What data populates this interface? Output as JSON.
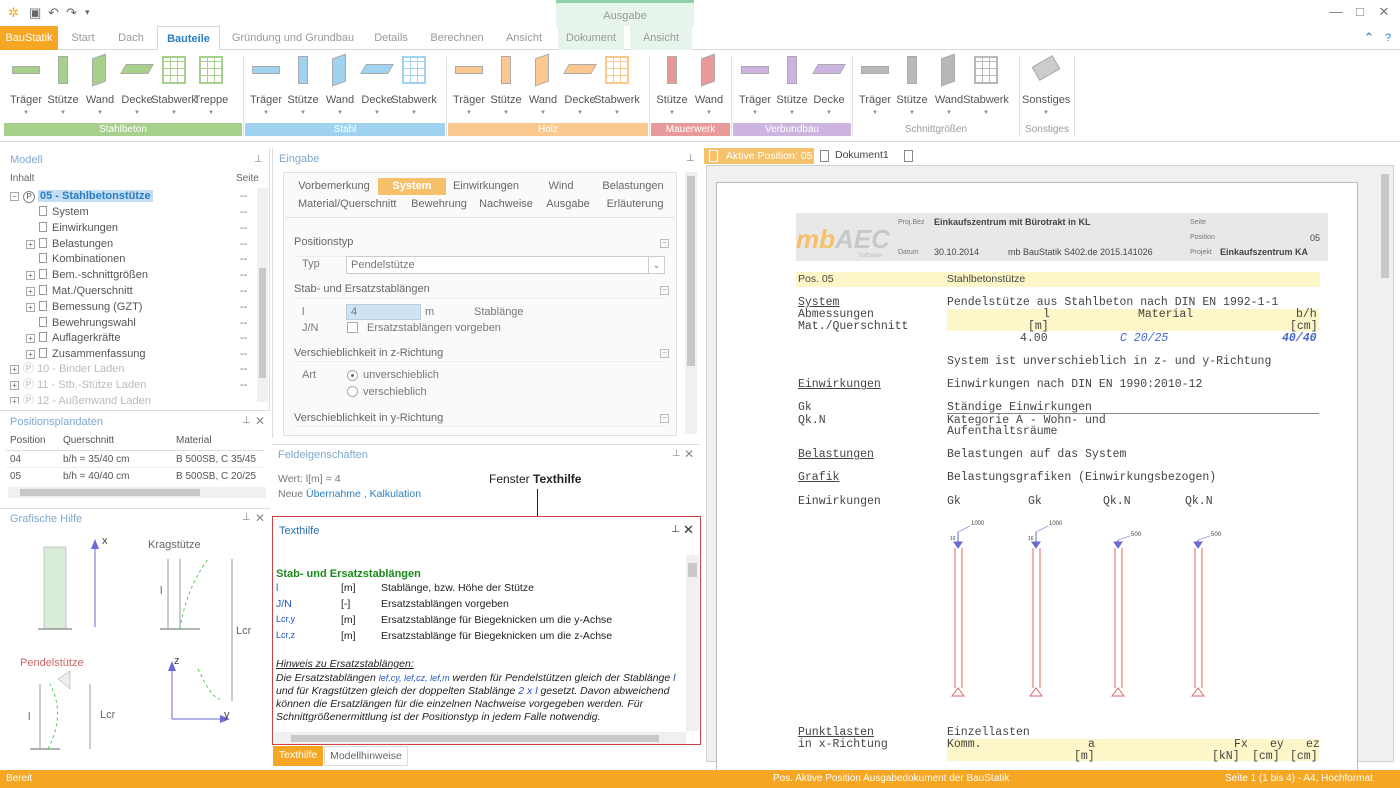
{
  "quick_access": {
    "save_icon": "save-icon",
    "undo_icon": "undo-icon",
    "redo_icon": "redo-icon"
  },
  "window": {
    "minimize": "—",
    "maximize": "□",
    "close": "✕"
  },
  "tabs": {
    "app": "BauStatik",
    "start": "Start",
    "dach": "Dach",
    "bauteile": "Bauteile",
    "gruendung": "Gründung und Grundbau",
    "details": "Details",
    "berechnen": "Berechnen",
    "ansicht": "Ansicht",
    "ctx_title": "Ausgabe",
    "dokument": "Dokument",
    "ansicht2": "Ansicht",
    "help": "?"
  },
  "ribbon": {
    "stahlbeton": [
      "Träger",
      "Stütze",
      "Wand",
      "Decke",
      "Stabwerk",
      "Treppe"
    ],
    "stahl": [
      "Träger",
      "Stütze",
      "Wand",
      "Decke",
      "Stabwerk"
    ],
    "holz": [
      "Träger",
      "Stütze",
      "Wand",
      "Decke",
      "Stabwerk"
    ],
    "mauerwerk": [
      "Stütze",
      "Wand"
    ],
    "verbundbau": [
      "Träger",
      "Stütze",
      "Decke"
    ],
    "schnittgroessen": [
      "Träger",
      "Stütze",
      "Wand",
      "Stabwerk"
    ],
    "sonstiges": [
      "Sonstiges"
    ],
    "groups": {
      "stahlbeton": "Stahlbeton",
      "stahl": "Stahl",
      "holz": "Holz",
      "mauerwerk": "Mauerwerk",
      "verbundbau": "Verbundbau",
      "schnittgroessen": "Schnittgrößen",
      "sonstiges": "Sonstiges"
    },
    "colors": {
      "stahlbeton": "#a8d08d",
      "stahl": "#9fd3ef",
      "holz": "#fbc990",
      "mauerwerk": "#e89a9a",
      "verbundbau": "#cdb4e0"
    }
  },
  "modell": {
    "title": "Modell",
    "col_inhalt": "Inhalt",
    "col_seite": "Seite",
    "root": "05 - Stahlbetonstütze",
    "root_badge": "P",
    "items": [
      {
        "label": "System",
        "val": "--",
        "exp": false
      },
      {
        "label": "Einwirkungen",
        "val": "--",
        "exp": false
      },
      {
        "label": "Belastungen",
        "val": "--",
        "exp": true
      },
      {
        "label": "Kombinationen",
        "val": "--",
        "exp": false
      },
      {
        "label": "Bem.-schnittgrößen",
        "val": "--",
        "exp": true
      },
      {
        "label": "Mat./Querschnitt",
        "val": "--",
        "exp": true
      },
      {
        "label": "Bemessung (GZT)",
        "val": "--",
        "exp": true
      },
      {
        "label": "Bewehrungswahl",
        "val": "--",
        "exp": false
      },
      {
        "label": "Auflagerkräfte",
        "val": "--",
        "exp": true
      },
      {
        "label": "Zusammenfassung",
        "val": "--",
        "exp": true
      }
    ],
    "other1": "10 - Binder Laden",
    "other2": "11 - Stb.-Stütze Laden",
    "other3": "12 - Außenwand Laden",
    "other_val": "--"
  },
  "positionsplan": {
    "title": "Positionsplandaten",
    "headers": [
      "Position",
      "Querschnitt",
      "Material"
    ],
    "rows": [
      [
        "04",
        "b/h = 35/40 cm",
        "B 500SB, C 35/45"
      ],
      [
        "05",
        "b/h = 40/40 cm",
        "B 500SB, C 20/25"
      ]
    ]
  },
  "grafische_hilfe": {
    "title": "Grafische Hilfe",
    "kragstuetze": "Kragstütze",
    "pendelstuetze": "Pendelstütze",
    "x": "x",
    "z": "z",
    "y": "y",
    "lcr": "Lcr",
    "l": "l"
  },
  "eingabe": {
    "title": "Eingabe",
    "tabs_row1": [
      "Vorbemerkung",
      "System",
      "Einwirkungen",
      "Wind",
      "Belastungen"
    ],
    "tabs_row2": [
      "Material/Querschnitt",
      "Bewehrung",
      "Nachweise",
      "Ausgabe",
      "Erläuterung"
    ],
    "sect_positionstyp": "Positionstyp",
    "typ_label": "Typ",
    "typ_value": "Pendelstütze",
    "sect_stab": "Stab- und Ersatzstablängen",
    "l_label": "l",
    "l_value": "4",
    "l_unit": "m",
    "l_desc": "Stablänge",
    "jn_label": "J/N",
    "jn_desc": "Ersatzstablängen vorgeben",
    "sect_vz": "Verschieblichkeit in z-Richtung",
    "art_label": "Art",
    "opt1": "unverschieblich",
    "opt2": "verschieblich",
    "sect_vy": "Verschieblichkeit in y-Richtung"
  },
  "feldeig": {
    "title": "Feldeigenschaften",
    "wert": "Wert: l[m] = 4",
    "neu": "Neue",
    "uebernahme": "Übernahme",
    "komma": ",",
    "kalkulation": "Kalkulation"
  },
  "annotation": {
    "prefix": "Fenster ",
    "bold": "Texthilfe"
  },
  "texthilfe": {
    "title": "Texthilfe",
    "heading": "Stab- und Ersatzstablängen",
    "rows": [
      {
        "sym": "l",
        "unit": "[m]",
        "desc": "Stablänge, bzw. Höhe der Stütze"
      },
      {
        "sym": "J/N",
        "unit": "[-]",
        "desc": "Ersatzstablängen vorgeben"
      },
      {
        "sym": "Lcr,y",
        "unit": "[m]",
        "desc": "Ersatzstablänge für Biegeknicken um die y-Achse"
      },
      {
        "sym": "Lcr,z",
        "unit": "[m]",
        "desc": "Ersatzstablänge für Biegeknicken um die z-Achse"
      }
    ],
    "hint_title": "Hinweis zu Ersatzstablängen:",
    "hint1a": "Die Ersatzstablängen ",
    "hint1b": "lef,cy, lef,cz, lef,m",
    "hint1c": " werden für Pendelstützen gleich der Stablänge ",
    "hint1d": "l",
    "hint2a": "und für Kragstützen gleich der doppelten Stablänge ",
    "hint2b": "2 x l",
    "hint2c": " gesetzt. Davon abweichend",
    "hint3": "können die Ersatzlängen für die einzelnen Nachweise vorgegeben werden. Für",
    "hint4": "Schnittgrößenermittlung ist der Positionstyp in jedem Falle notwendig.",
    "tab1": "Texthilfe",
    "tab2": "Modellhinweise"
  },
  "doc": {
    "tab_active": "Aktive Position: 05",
    "tab2": "Dokument1",
    "header": {
      "projbez_l": "Proj.Bez",
      "projbez": "Einkaufszentrum mit Bürotrakt in KL",
      "seite_l": "Seite",
      "position_l": "Position",
      "position": "05",
      "datum_l": "Datum",
      "datum": "30.10.2014",
      "prog": "mb BauStatik S402.de  2015.141026",
      "projekt_l": "Projekt",
      "projekt": "Einkaufszentrum KA",
      "logo1": "mb",
      "logo2": "AEC",
      "logo_sub": "Software"
    },
    "pos": "Pos. 05",
    "pos_title": "Stahlbetonstütze",
    "system_h": "System",
    "system_t": "Pendelstütze aus Stahlbeton nach DIN EN 1992-1-1",
    "abm": "Abmessungen",
    "matq": "Mat./Querschnitt",
    "col_l": "l",
    "col_mat": "Material",
    "col_bh": "b/h",
    "unit_m": "[m]",
    "unit_cm": "[cm]",
    "val_l": "4.00",
    "val_mat": "C 20/25",
    "val_bh": "40/40",
    "unversch": "System ist unverschieblich in z- und y-Richtung",
    "einw_h": "Einwirkungen",
    "einw_t": "Einwirkungen nach DIN EN 1990:2010-12",
    "gk": "Gk",
    "gk_t": "Ständige Einwirkungen",
    "qkn": "Qk.N",
    "qkn_t1": "Kategorie A - Wohn- und",
    "qkn_t2": "Aufenthaltsräume",
    "bel_h": "Belastungen",
    "bel_t": "Belastungen auf das System",
    "graf_h": "Grafik",
    "graf_t": "Belastungsgrafiken (Einwirkungsbezogen)",
    "einw2": "Einwirkungen",
    "g1": "Gk",
    "g2": "Gk",
    "g3": "Qk.N",
    "g4": "Qk.N",
    "load1": "1000",
    "load2": "1000",
    "load3": "500",
    "load4": "500",
    "small1": "16",
    "small2": "16",
    "punkt_h": "Punktlasten",
    "punkt_t": "Einzellasten",
    "xr": "in x-Richtung",
    "komm": "Komm.",
    "pa": "a",
    "pfx": "Fx",
    "pey": "ey",
    "pez": "ez",
    "pu_m": "[m]",
    "pu_kn": "[kN]",
    "pu_cm1": "[cm]",
    "pu_cm2": "[cm]"
  },
  "status": {
    "left": "Bereit",
    "mid": "Pos. Aktive Position  Ausgabedokument der BauStatik",
    "right": "Seite 1 (1 bis 4) - A4, Hochformat"
  }
}
